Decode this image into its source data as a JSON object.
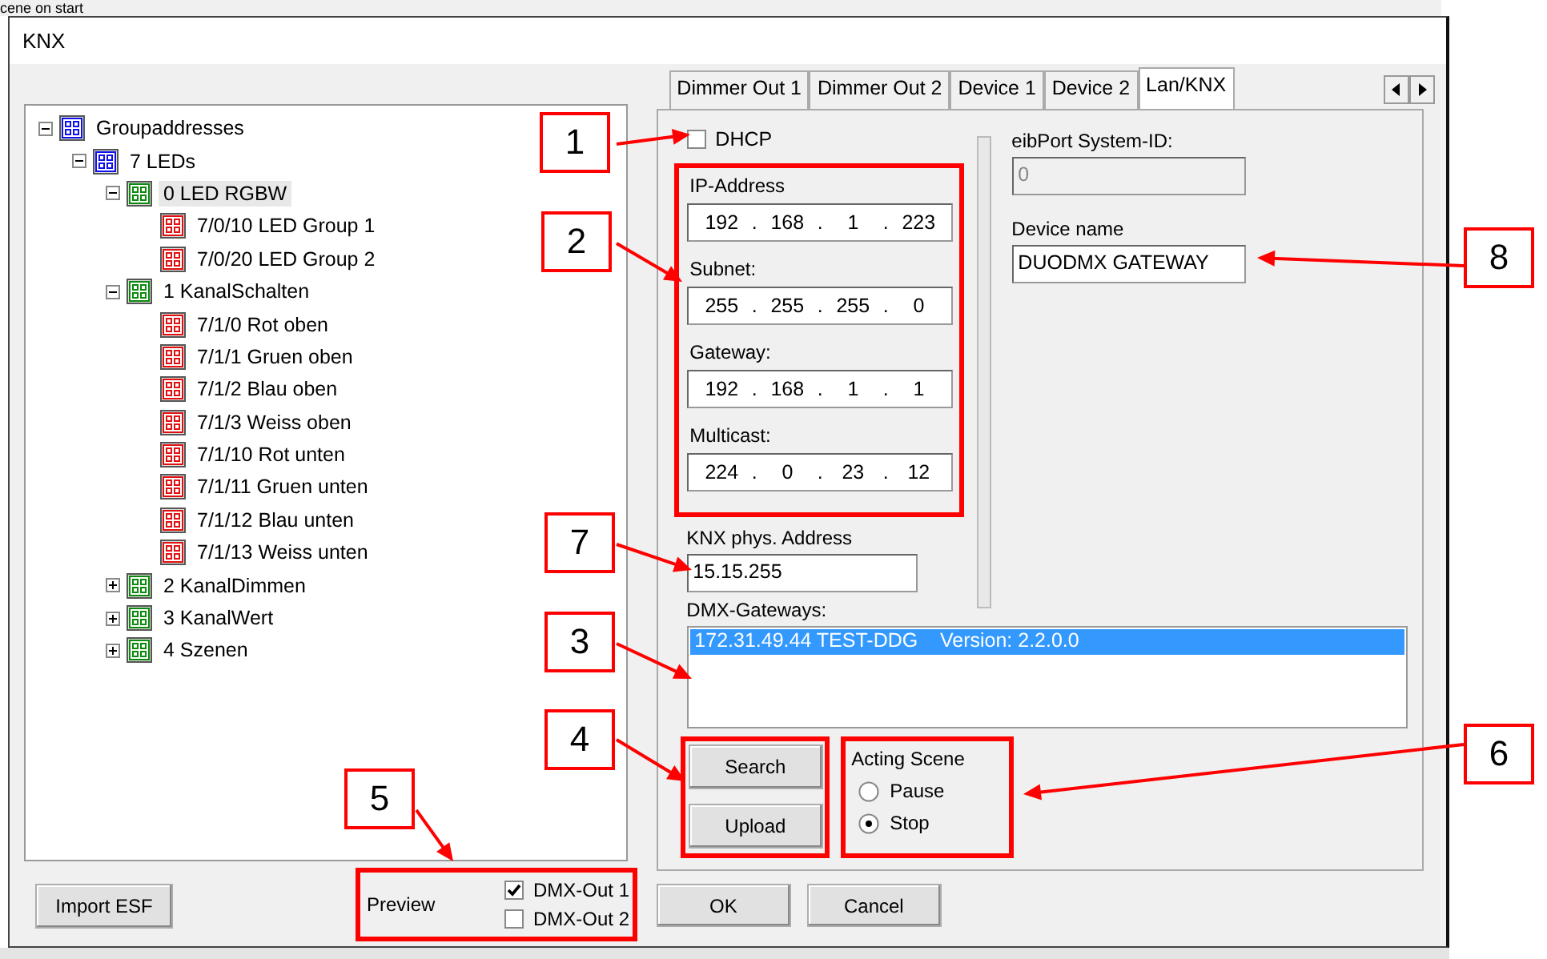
{
  "background": {
    "dropdown_text": "cene on start"
  },
  "window": {
    "title": "KNX"
  },
  "tree": {
    "items": [
      {
        "label": "Groupaddresses",
        "kind": "root",
        "expanded": true,
        "selected": false,
        "children": [
          {
            "label": "7 LEDs",
            "kind": "root",
            "expanded": true,
            "selected": false,
            "children": [
              {
                "label": "0 LED RGBW",
                "kind": "middle",
                "expanded": true,
                "selected": true,
                "children": [
                  {
                    "label": "7/0/10 LED Group 1",
                    "kind": "address",
                    "selected": false
                  },
                  {
                    "label": "7/0/20 LED Group 2",
                    "kind": "address",
                    "selected": false
                  }
                ]
              },
              {
                "label": "1 KanalSchalten",
                "kind": "middle",
                "expanded": true,
                "selected": false,
                "children": [
                  {
                    "label": "7/1/0 Rot oben",
                    "kind": "address",
                    "selected": false
                  },
                  {
                    "label": "7/1/1 Gruen oben",
                    "kind": "address",
                    "selected": false
                  },
                  {
                    "label": "7/1/2 Blau oben",
                    "kind": "address",
                    "selected": false
                  },
                  {
                    "label": "7/1/3 Weiss oben",
                    "kind": "address",
                    "selected": false
                  },
                  {
                    "label": "7/1/10 Rot unten",
                    "kind": "address",
                    "selected": false
                  },
                  {
                    "label": "7/1/11 Gruen unten",
                    "kind": "address",
                    "selected": false
                  },
                  {
                    "label": "7/1/12 Blau unten",
                    "kind": "address",
                    "selected": false
                  },
                  {
                    "label": "7/1/13 Weiss unten",
                    "kind": "address",
                    "selected": false
                  }
                ]
              },
              {
                "label": "2 KanalDimmen",
                "kind": "middle",
                "expanded": false,
                "selected": false
              },
              {
                "label": "3 KanalWert",
                "kind": "middle",
                "expanded": false,
                "selected": false
              },
              {
                "label": "4 Szenen",
                "kind": "middle",
                "expanded": false,
                "selected": false
              }
            ]
          }
        ]
      }
    ]
  },
  "import_button": "Import ESF",
  "preview": {
    "label": "Preview",
    "outputs": [
      {
        "label": "DMX-Out 1",
        "checked": true
      },
      {
        "label": "DMX-Out 2",
        "checked": false
      }
    ]
  },
  "tabs": [
    {
      "label": "Dimmer Out 1",
      "selected": false
    },
    {
      "label": "Dimmer Out 2",
      "selected": false
    },
    {
      "label": "Device 1",
      "selected": false
    },
    {
      "label": "Device 2",
      "selected": false
    },
    {
      "label": "Lan/KNX",
      "selected": true
    }
  ],
  "lan": {
    "dhcp": {
      "label": "DHCP",
      "checked": false
    },
    "separator": ".",
    "ip_fields": [
      {
        "label": "IP-Address",
        "octets": [
          "192",
          "168",
          "1",
          "223"
        ]
      },
      {
        "label": "Subnet:",
        "octets": [
          "255",
          "255",
          "255",
          "0"
        ]
      },
      {
        "label": "Gateway:",
        "octets": [
          "192",
          "168",
          "1",
          "1"
        ]
      },
      {
        "label": "Multicast:",
        "octets": [
          "224",
          "0",
          "23",
          "12"
        ]
      }
    ],
    "knx_address": {
      "label": "KNX phys. Address",
      "value": "15.15.255"
    },
    "dmx_gateways": {
      "label": "DMX-Gateways:",
      "rows": [
        {
          "address": "172.31.49.44 TEST-DDG",
          "version": "Version: 2.2.0.0",
          "selected": true
        }
      ]
    },
    "system_id": {
      "label": "eibPort System-ID:",
      "value": "0",
      "disabled": true
    },
    "device_name": {
      "label": "Device name",
      "value": "DUODMX GATEWAY",
      "disabled": false
    },
    "actions": [
      "Search",
      "Upload"
    ],
    "acting_scene": {
      "title": "Acting Scene",
      "options": [
        {
          "label": "Pause",
          "selected": false
        },
        {
          "label": "Stop",
          "selected": true
        }
      ]
    }
  },
  "dialog_buttons": [
    "OK",
    "Cancel"
  ],
  "callouts": [
    {
      "number": "1"
    },
    {
      "number": "2"
    },
    {
      "number": "7"
    },
    {
      "number": "3"
    },
    {
      "number": "4"
    },
    {
      "number": "5"
    },
    {
      "number": "6"
    },
    {
      "number": "8"
    }
  ]
}
